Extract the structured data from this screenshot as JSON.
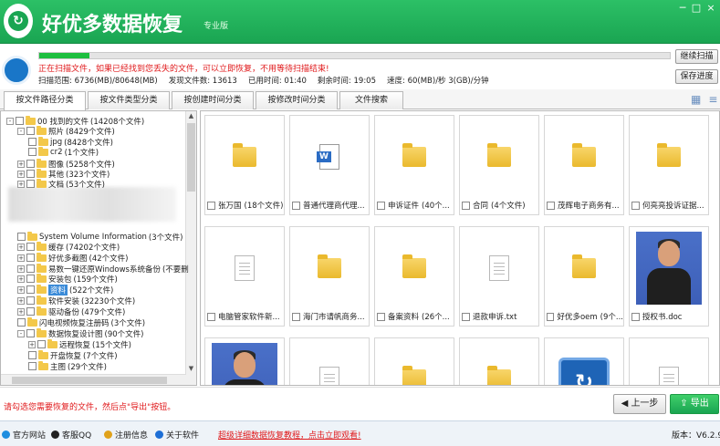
{
  "app": {
    "title": "好优多数据恢复",
    "edition": "专业版"
  },
  "window_controls": {
    "min": "─",
    "max": "□",
    "close": "×"
  },
  "scan": {
    "progress_percent": 8,
    "status": "正在扫描文件，如果已经找到您丢失的文件，可以立即恢复，不用等待扫描结束!",
    "stats": [
      {
        "label": "扫描范围:",
        "value": "6736(MB)/80648(MB)"
      },
      {
        "label": "发现文件数:",
        "value": "13613"
      },
      {
        "label": "已用时间:",
        "value": "01:40"
      },
      {
        "label": "剩余时间:",
        "value": "19:05"
      },
      {
        "label": "速度:",
        "value": "60(MB)/秒 3(GB)/分钟"
      }
    ],
    "continue_label": "继续扫描",
    "save_label": "保存进度"
  },
  "tabs": [
    {
      "label": "按文件路径分类",
      "active": true
    },
    {
      "label": "按文件类型分类",
      "active": false
    },
    {
      "label": "按创建时间分类",
      "active": false
    },
    {
      "label": "按修改时间分类",
      "active": false
    },
    {
      "label": "文件搜索",
      "active": false
    }
  ],
  "view_icons": [
    "grid-view-icon",
    "list-view-icon"
  ],
  "tree": [
    {
      "label": "00 找到的文件",
      "count": "(14208个文件)",
      "level": 0,
      "expander": "-"
    },
    {
      "label": "照片",
      "count": "(8429个文件)",
      "level": 1,
      "expander": "-"
    },
    {
      "label": "jpg",
      "count": "(8428个文件)",
      "level": 2,
      "expander": ""
    },
    {
      "label": "cr2",
      "count": "(1个文件)",
      "level": 2,
      "expander": ""
    },
    {
      "label": "图像",
      "count": "(5258个文件)",
      "level": 1,
      "expander": "+"
    },
    {
      "label": "其他",
      "count": "(323个文件)",
      "level": 1,
      "expander": "+"
    },
    {
      "label": "文档",
      "count": "(53个文件)",
      "level": 1,
      "expander": "+"
    },
    {
      "label": "System Volume Information",
      "count": "(3个文件)",
      "level": 1,
      "expander": ""
    },
    {
      "label": "缓存",
      "count": "(74202个文件)",
      "level": 1,
      "expander": "+"
    },
    {
      "label": "好优多截图",
      "count": "(42个文件)",
      "level": 1,
      "expander": "+"
    },
    {
      "label": "易数一键还原Windows系统备份",
      "count": "(不要删",
      "level": 1,
      "expander": "+"
    },
    {
      "label": "安装包",
      "count": "(159个文件)",
      "level": 1,
      "expander": "+"
    },
    {
      "label": "资料",
      "count": "(522个文件)",
      "level": 1,
      "expander": "+",
      "selected": true
    },
    {
      "label": "软件安装",
      "count": "(32230个文件)",
      "level": 1,
      "expander": "+"
    },
    {
      "label": "驱动备份",
      "count": "(479个文件)",
      "level": 1,
      "expander": "+"
    },
    {
      "label": "闪电视频恢复注册码",
      "count": "(3个文件)",
      "level": 1,
      "expander": ""
    },
    {
      "label": "数据恢复设计图",
      "count": "(90个文件)",
      "level": 1,
      "expander": "-"
    },
    {
      "label": "远程恢复",
      "count": "(15个文件)",
      "level": 2,
      "expander": "+"
    },
    {
      "label": "开盘恢复",
      "count": "(7个文件)",
      "level": 2,
      "expander": ""
    },
    {
      "label": "主图",
      "count": "(29个文件)",
      "level": 2,
      "expander": ""
    }
  ],
  "files": [
    {
      "name": "张万国",
      "detail": "(18个文件)",
      "type": "folder"
    },
    {
      "name": "普通代理商代理...",
      "detail": "",
      "type": "word"
    },
    {
      "name": "申诉证件",
      "detail": "(40个...",
      "type": "folder"
    },
    {
      "name": "合同",
      "detail": "(4个文件)",
      "type": "folder"
    },
    {
      "name": "茂辉电子商务有...",
      "detail": "",
      "type": "folder"
    },
    {
      "name": "何亮亮投诉证据...",
      "detail": "",
      "type": "folder"
    },
    {
      "name": "电脑管家软件新...",
      "detail": "",
      "type": "doc"
    },
    {
      "name": "海门市请帆商务...",
      "detail": "",
      "type": "folder"
    },
    {
      "name": "备案资料",
      "detail": "(26个...",
      "type": "folder"
    },
    {
      "name": "退款申诉.txt",
      "detail": "",
      "type": "doc"
    },
    {
      "name": "好优多oem",
      "detail": "(9个...",
      "type": "folder"
    },
    {
      "name": "授权书.doc",
      "detail": "",
      "type": "photo"
    },
    {
      "name": "",
      "detail": "",
      "type": "photo"
    },
    {
      "name": "",
      "detail": "",
      "type": "doc"
    },
    {
      "name": "",
      "detail": "",
      "type": "folder"
    },
    {
      "name": "",
      "detail": "",
      "type": "folder"
    },
    {
      "name": "",
      "detail": "",
      "type": "app"
    },
    {
      "name": "",
      "detail": "",
      "type": "doc"
    }
  ],
  "bottom": {
    "hint": "请勾选您需要恢复的文件，然后点\"导出\"按钮。",
    "prev_label": "上一步",
    "export_label": "导出"
  },
  "statusbar": {
    "items": [
      {
        "label": "官方网站",
        "icon": "globe-icon",
        "color": "#1e8ee0"
      },
      {
        "label": "客服QQ",
        "icon": "qq-icon",
        "color": "#222222"
      },
      {
        "label": "注册信息",
        "icon": "key-icon",
        "color": "#e0a21b"
      },
      {
        "label": "关于软件",
        "icon": "info-icon",
        "color": "#1e6fd6"
      }
    ],
    "tutorial_link": "超级详细数据恢复教程，点击立即观看!",
    "version_label": "版本：",
    "version": "V6.2.9"
  }
}
